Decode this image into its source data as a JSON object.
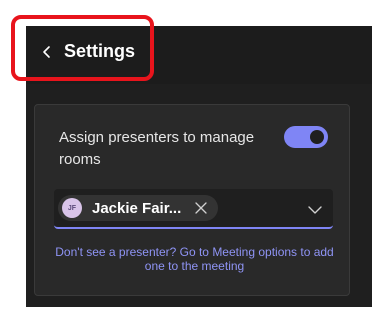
{
  "header": {
    "back_icon": "chevron-left-icon",
    "title": "Settings"
  },
  "presenters": {
    "assign_label": "Assign presenters to manage rooms",
    "toggle_state": "on",
    "selected": {
      "initials": "JF",
      "name": "Jackie Fair..."
    },
    "hint": "Don't see a presenter? Go to Meeting options to add one to the meeting"
  },
  "colors": {
    "accent": "#7f85f5",
    "highlight": "#e8141c",
    "panel_bg": "#1f1f1f",
    "card_bg": "#292929"
  }
}
